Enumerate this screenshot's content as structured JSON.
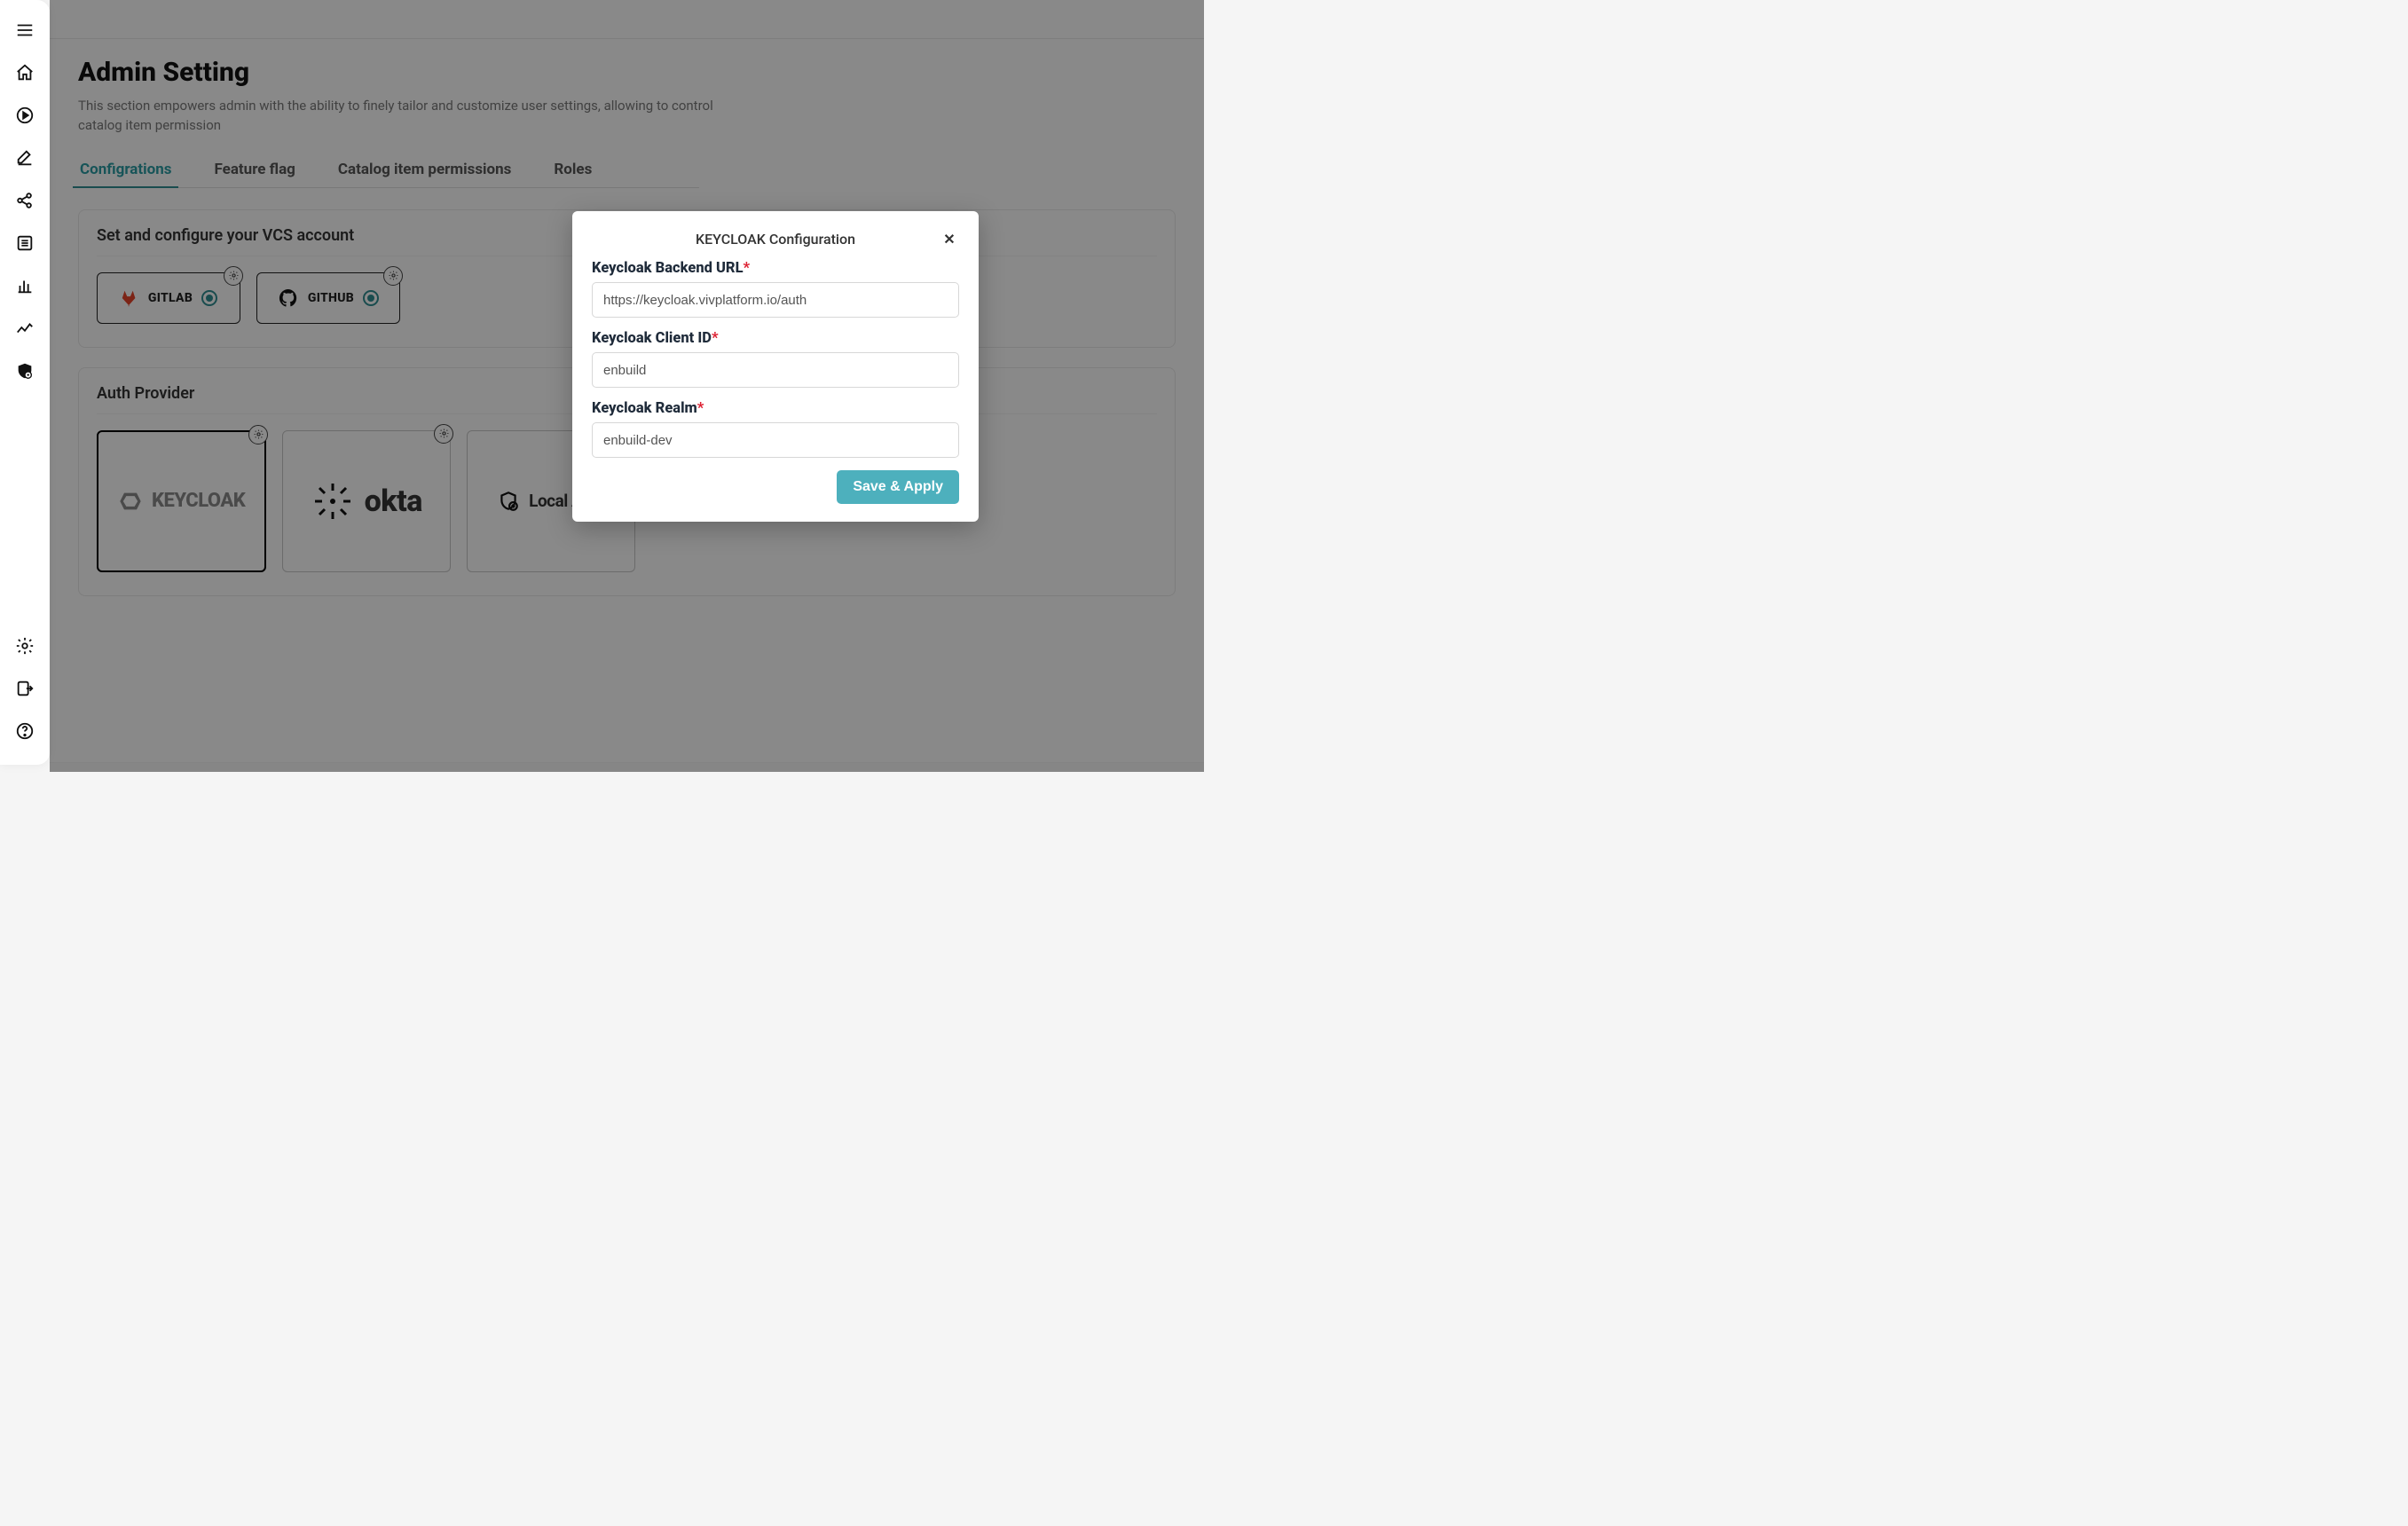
{
  "page": {
    "title": "Admin Setting",
    "desc": "This section empowers admin with the ability to finely tailor and customize user settings, allowing to control catalog item permission"
  },
  "tabs": {
    "configurations": "Configrations",
    "feature_flag": "Feature flag",
    "catalog_perm": "Catalog item permissions",
    "roles": "Roles"
  },
  "vcs": {
    "heading": "Set and configure your VCS account",
    "gitlab": "GITLAB",
    "github": "GITHUB"
  },
  "auth": {
    "heading": "Auth Provider",
    "keycloak": "KEYCLOAK",
    "okta": "okta",
    "local": "Local Auth"
  },
  "modal": {
    "title": "KEYCLOAK Configuration",
    "backend_label": "Keycloak Backend URL",
    "backend_value": "https://keycloak.vivplatform.io/auth",
    "client_label": "Keycloak Client ID",
    "client_value": "enbuild",
    "realm_label": "Keycloak Realm",
    "realm_value": "enbuild-dev",
    "save": "Save & Apply"
  }
}
